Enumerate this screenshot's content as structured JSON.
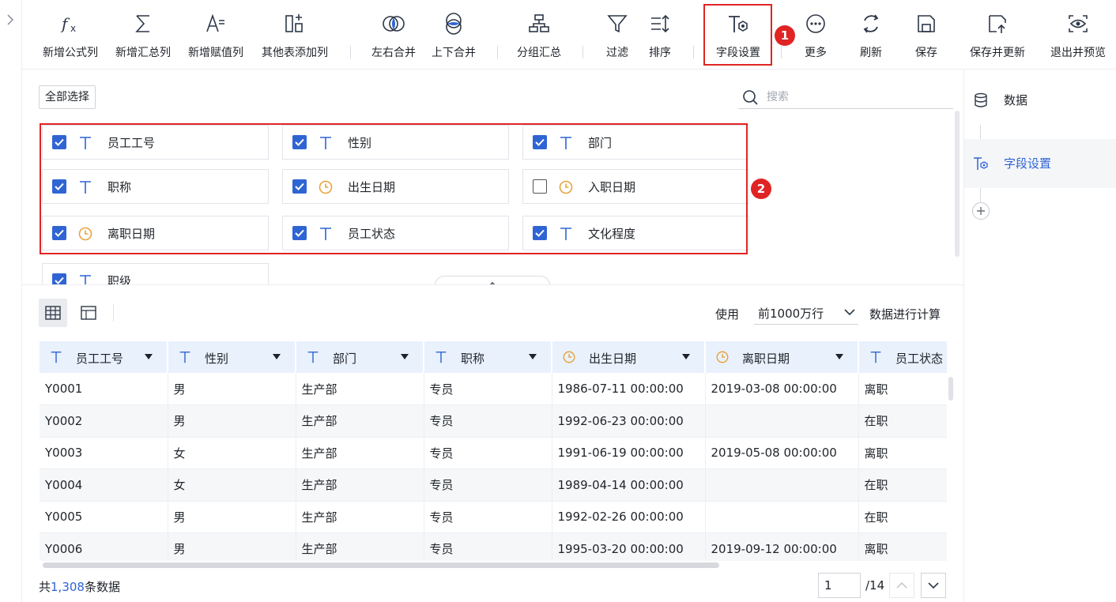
{
  "toolbar": {
    "items": [
      {
        "id": "add-formula",
        "label": "新增公式列",
        "icon": "formula-icon"
      },
      {
        "id": "add-summary",
        "label": "新增汇总列",
        "icon": "sigma-icon"
      },
      {
        "id": "add-assign",
        "label": "新增赋值列",
        "icon": "assign-icon"
      },
      {
        "id": "add-other",
        "label": "其他表添加列",
        "icon": "add-column-icon"
      },
      {
        "id": "merge-lr",
        "label": "左右合并",
        "icon": "merge-horizontal-icon"
      },
      {
        "id": "merge-tb",
        "label": "上下合并",
        "icon": "merge-vertical-icon"
      },
      {
        "id": "group-summary",
        "label": "分组汇总",
        "icon": "group-icon"
      },
      {
        "id": "filter",
        "label": "过滤",
        "icon": "filter-icon"
      },
      {
        "id": "sort",
        "label": "排序",
        "icon": "sort-icon"
      },
      {
        "id": "field-settings",
        "label": "字段设置",
        "icon": "field-settings-icon"
      },
      {
        "id": "more",
        "label": "更多",
        "icon": "more-icon"
      },
      {
        "id": "refresh",
        "label": "刷新",
        "icon": "refresh-icon"
      },
      {
        "id": "save",
        "label": "保存",
        "icon": "save-icon"
      },
      {
        "id": "save-update",
        "label": "保存并更新",
        "icon": "save-update-icon"
      },
      {
        "id": "exit-preview",
        "label": "退出并预览",
        "icon": "preview-icon"
      }
    ],
    "badge1": "1",
    "badge2": "2"
  },
  "fields": {
    "select_all_label": "全部选择",
    "search_placeholder": "搜索",
    "items": [
      {
        "name": "员工工号",
        "type": "text",
        "checked": true
      },
      {
        "name": "性别",
        "type": "text",
        "checked": true
      },
      {
        "name": "部门",
        "type": "text",
        "checked": true
      },
      {
        "name": "职称",
        "type": "text",
        "checked": true
      },
      {
        "name": "出生日期",
        "type": "date",
        "checked": true
      },
      {
        "name": "入职日期",
        "type": "date",
        "checked": false
      },
      {
        "name": "离职日期",
        "type": "date",
        "checked": true
      },
      {
        "name": "员工状态",
        "type": "text",
        "checked": true
      },
      {
        "name": "文化程度",
        "type": "text",
        "checked": true
      },
      {
        "name": "职级",
        "type": "text",
        "checked": true
      }
    ]
  },
  "table": {
    "use_label": "使用",
    "rows_option": "前1000万行",
    "calc_label": "数据进行计算",
    "columns": [
      {
        "name": "员工工号",
        "type": "text"
      },
      {
        "name": "性别",
        "type": "text"
      },
      {
        "name": "部门",
        "type": "text"
      },
      {
        "name": "职称",
        "type": "text"
      },
      {
        "name": "出生日期",
        "type": "date"
      },
      {
        "name": "离职日期",
        "type": "date"
      },
      {
        "name": "员工状态",
        "type": "text"
      }
    ],
    "rows": [
      [
        "Y0001",
        "男",
        "生产部",
        "专员",
        "1986-07-11 00:00:00",
        "2019-03-08 00:00:00",
        "离职"
      ],
      [
        "Y0002",
        "男",
        "生产部",
        "专员",
        "1992-06-23 00:00:00",
        "",
        "在职"
      ],
      [
        "Y0003",
        "女",
        "生产部",
        "专员",
        "1991-06-19 00:00:00",
        "2019-05-08 00:00:00",
        "离职"
      ],
      [
        "Y0004",
        "女",
        "生产部",
        "专员",
        "1989-04-14 00:00:00",
        "",
        "在职"
      ],
      [
        "Y0005",
        "男",
        "生产部",
        "专员",
        "1992-02-26 00:00:00",
        "",
        "在职"
      ],
      [
        "Y0006",
        "男",
        "生产部",
        "专员",
        "1995-03-20 00:00:00",
        "2019-09-12 00:00:00",
        "离职"
      ]
    ],
    "total_prefix": "共",
    "total_count": "1,308",
    "total_suffix": "条数据",
    "page_current": "1",
    "page_total": "/14"
  },
  "right_panel": {
    "items": [
      {
        "label": "数据",
        "icon": "database-icon",
        "active": false
      },
      {
        "label": "字段设置",
        "icon": "field-settings-icon",
        "active": true
      }
    ]
  },
  "colors": {
    "accent": "#2f64d3",
    "highlight": "#e02424",
    "date_icon": "#e8a33d"
  }
}
